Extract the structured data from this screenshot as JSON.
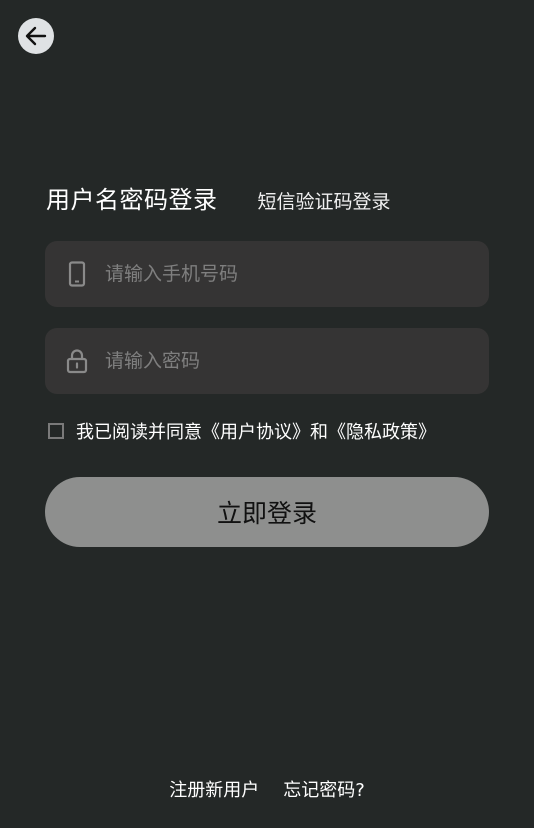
{
  "header": {
    "back_icon": "arrow-left-icon"
  },
  "tabs": {
    "active_label": "用户名密码登录",
    "inactive_label": "短信验证码登录"
  },
  "form": {
    "phone": {
      "icon": "phone-icon",
      "placeholder": "请输入手机号码",
      "value": ""
    },
    "password": {
      "icon": "lock-icon",
      "placeholder": "请输入密码",
      "value": ""
    },
    "agreement": {
      "checked": false,
      "text": "我已阅读并同意《用户协议》和《隐私政策》"
    },
    "submit_label": "立即登录"
  },
  "footer": {
    "register_label": "注册新用户",
    "forgot_label": "忘记密码?"
  },
  "colors": {
    "background": "#242827",
    "field_background": "#353434",
    "button_background": "#8e8f8e",
    "placeholder": "#7f7f7f"
  }
}
